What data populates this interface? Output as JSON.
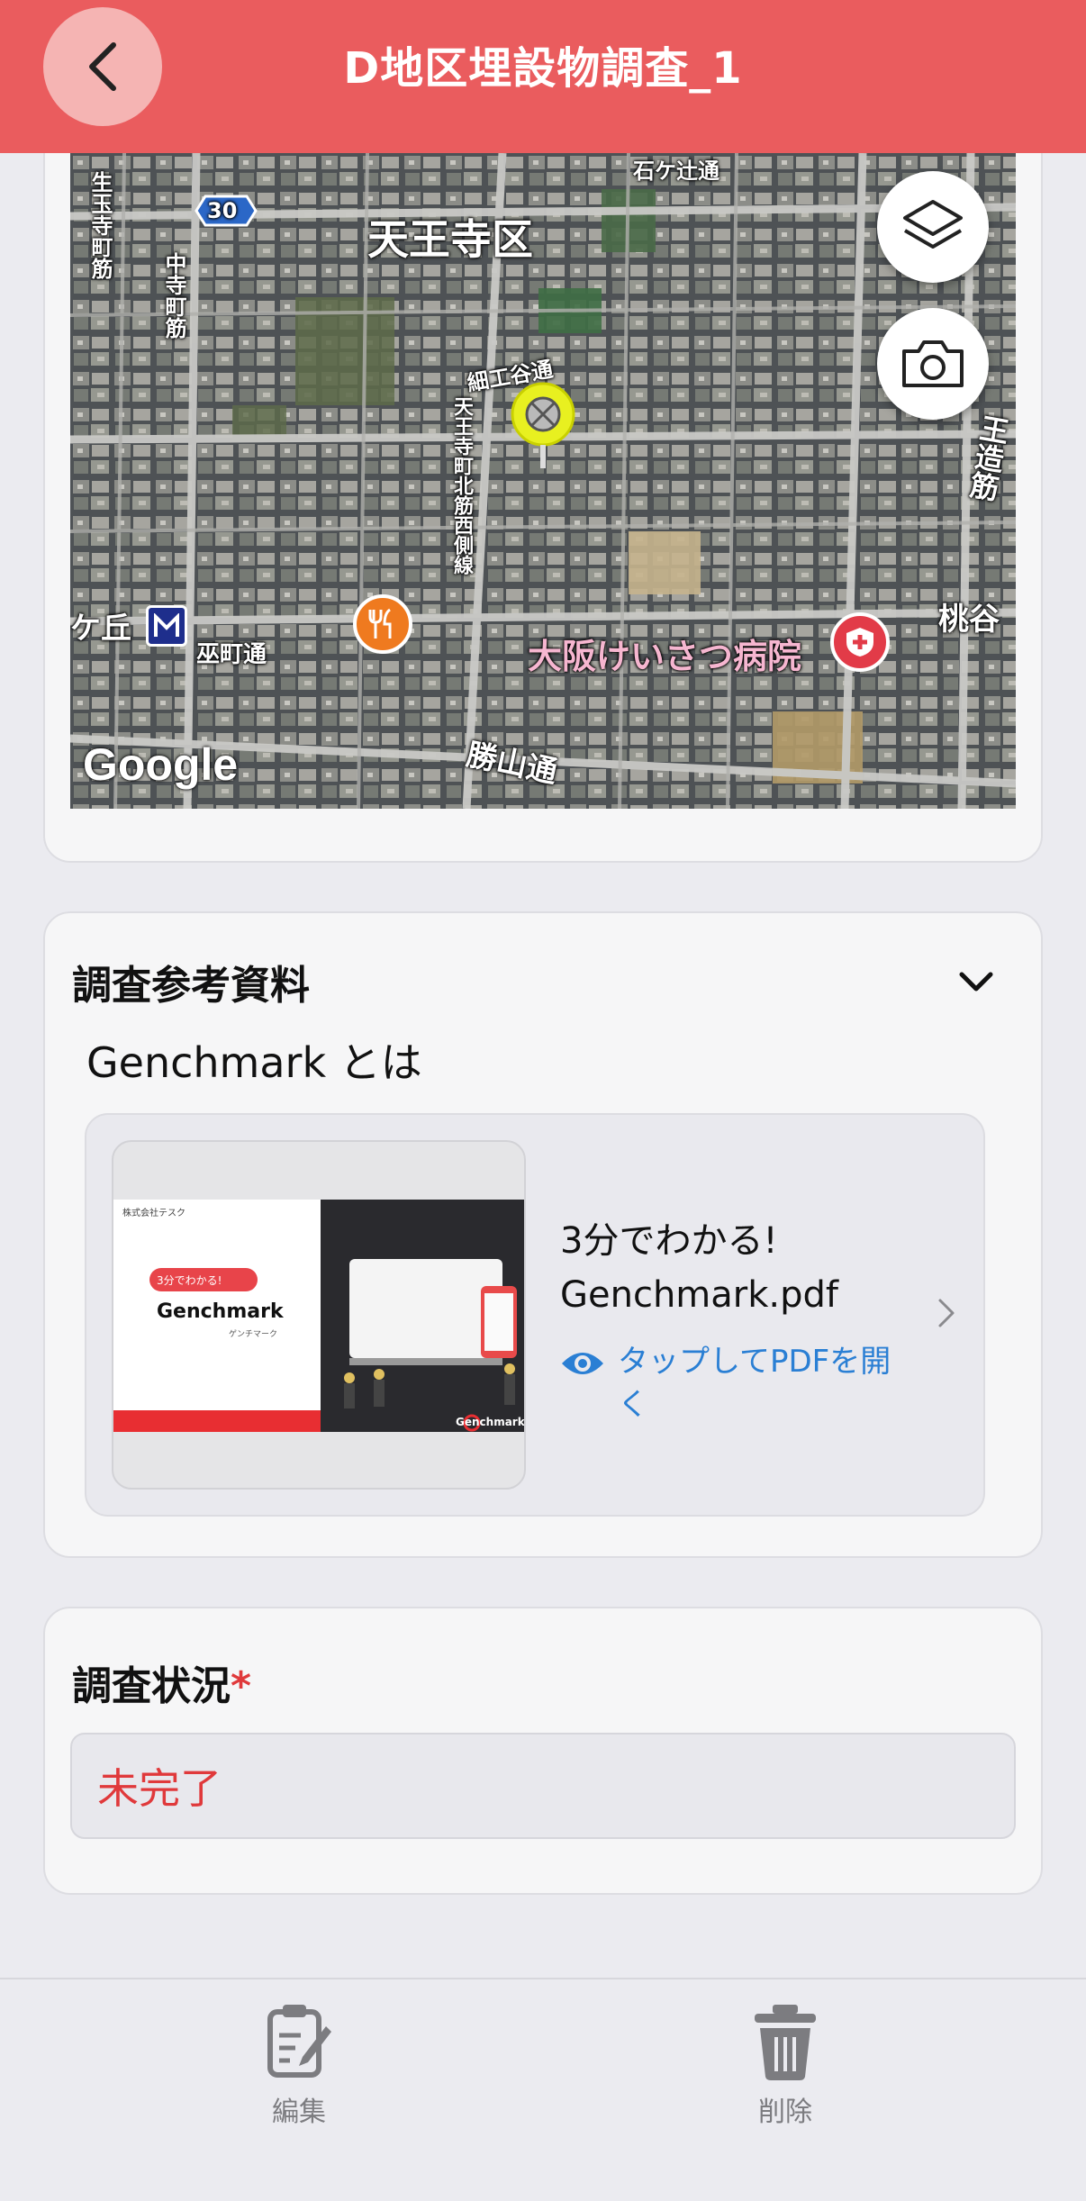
{
  "header": {
    "title": "D地区埋設物調査_1",
    "back_icon": "chevron-left-icon",
    "color": "#ea5c5e"
  },
  "map": {
    "labels": {
      "ward": "天王寺区",
      "ishikiri": "石ケ辻通",
      "ikutamadera": "生玉寺町筋",
      "nakadera": "中寺町筋",
      "saikudani": "細工谷通",
      "tennoji_line": "天王寺町北筋西側線",
      "keoka": "ケ丘",
      "mikannagi": "巫町通",
      "hospital": "大阪けいさつ病院",
      "oji": "王造筋",
      "momodani": "桃谷",
      "katsuyama": "勝山通",
      "route": "30",
      "google": "Google"
    },
    "layers_icon": "layers-icon",
    "camera_icon": "camera-icon"
  },
  "reference": {
    "section_title": "調査参考資料",
    "subtitle": "Genchmark とは",
    "pdf": {
      "name_line1": "3分でわかる!",
      "name_line2": "Genchmark.pdf",
      "open_label": "タップしてPDFを開く",
      "thumb": {
        "company": "株式会社テスク",
        "bubble": "3分でわかる!",
        "brand": "Genchmark",
        "reading": "ゲンチマーク",
        "logo": "Genchmark"
      }
    }
  },
  "status": {
    "title": "調査状況",
    "required_mark": "*",
    "value": "未完了"
  },
  "bottom_bar": {
    "edit_label": "編集",
    "delete_label": "削除"
  }
}
